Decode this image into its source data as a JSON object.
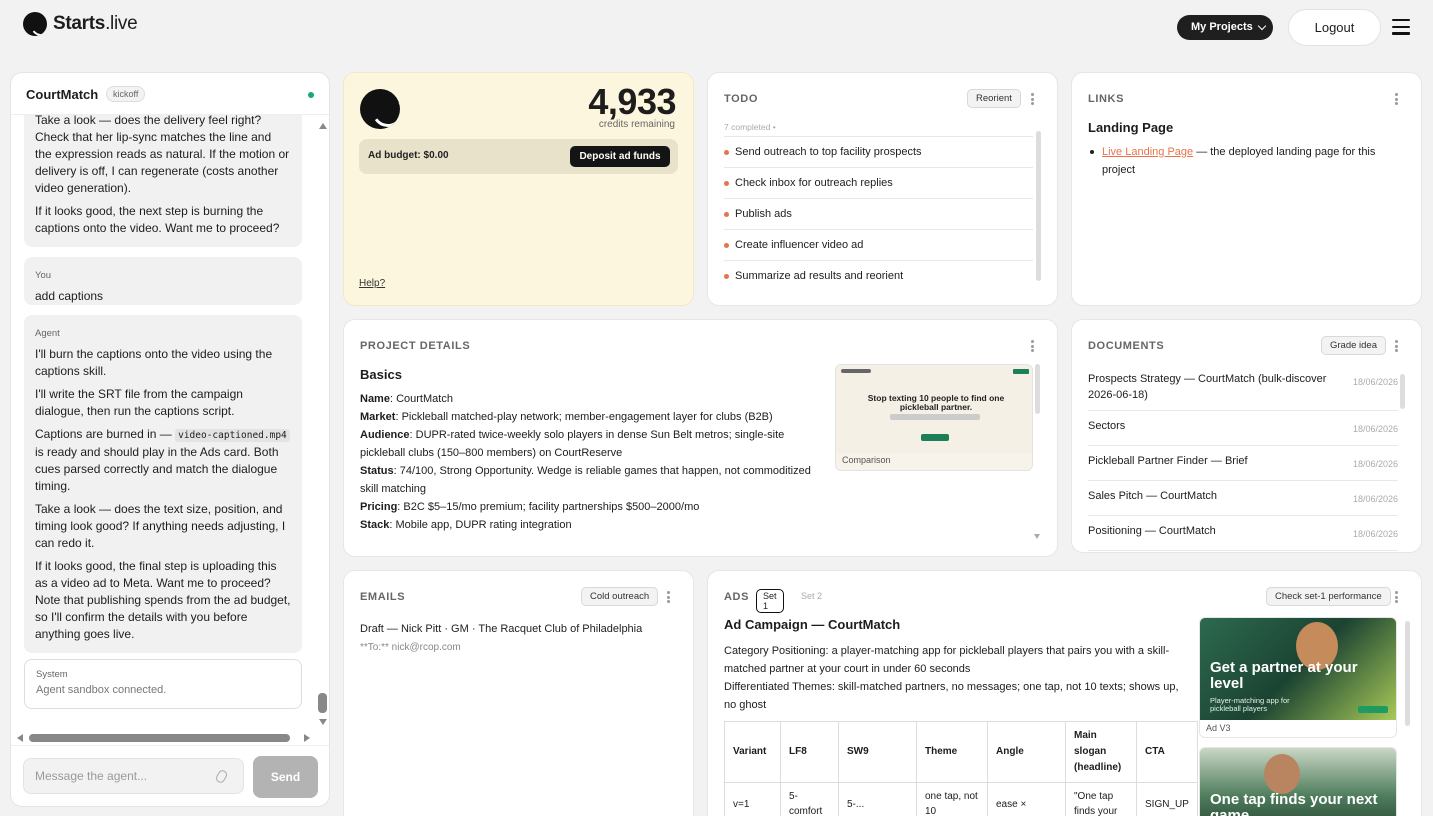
{
  "header": {
    "brand": "Starts",
    "brand_suffix": ".live",
    "projects_label": "My Projects",
    "logout_label": "Logout"
  },
  "chat": {
    "title": "CourtMatch",
    "badge": "kickoff",
    "messages": [
      {
        "who": "",
        "paras": [
          "Take a look — does the delivery feel right? Check that her lip-sync matches the line and the expression reads as natural. If the motion or delivery is off, I can regenerate (costs another video generation).",
          "If it looks good, the next step is burning the captions onto the video. Want me to proceed?"
        ]
      },
      {
        "who": "You",
        "paras": [
          "add captions"
        ]
      },
      {
        "who": "Agent",
        "paras": [
          "I'll burn the captions onto the video using the captions skill.",
          "I'll write the SRT file from the campaign dialogue, then run the captions script.",
          "Captions are burned in —",
          "video-captioned.mp4",
          "is ready and should play in the Ads card. Both cues parsed correctly and match the dialogue timing.",
          "Take a look — does the text size, position, and timing look good? If anything needs adjusting, I can redo it.",
          "If it looks good, the final step is uploading this as a video ad to Meta. Want me to proceed? Note that publishing spends from the ad budget, so I'll confirm the details with you before anything goes live."
        ]
      }
    ],
    "system": {
      "who": "System",
      "text": "Agent sandbox connected."
    },
    "input_placeholder": "Message the agent...",
    "send_label": "Send"
  },
  "credits": {
    "value": "4,933",
    "label": "credits remaining",
    "budget": "Ad budget: $0.00",
    "deposit_label": "Deposit ad funds",
    "help": "Help?"
  },
  "todo": {
    "title": "TODO",
    "action": "Reorient",
    "meta": "7 completed",
    "meta_sep": "•",
    "items": [
      "Send outreach to top facility prospects",
      "Check inbox for outreach replies",
      "Publish ads",
      "Create influencer video ad",
      "Summarize ad results and reorient"
    ]
  },
  "links": {
    "title": "LINKS",
    "heading": "Landing Page",
    "link_text": "Live Landing Page",
    "link_desc": " — the deployed landing page for this project"
  },
  "project": {
    "title": "PROJECT DETAILS",
    "heading": "Basics",
    "fields": [
      {
        "k": "Name",
        "v": ": CourtMatch"
      },
      {
        "k": "Market",
        "v": ": Pickleball matched-play network; member-engagement layer for clubs (B2B)"
      },
      {
        "k": "Audience",
        "v": ": DUPR-rated twice-weekly solo players in dense Sun Belt metros; single-site pickleball clubs (150–800 members) on CourtReserve"
      },
      {
        "k": "Status",
        "v": ": 74/100, Strong Opportunity. Wedge is reliable games that happen, not commoditized skill matching"
      },
      {
        "k": "Pricing",
        "v": ": B2C $5–15/mo premium; facility partnerships $500–2000/mo"
      },
      {
        "k": "Stack",
        "v": ": Mobile app, DUPR rating integration"
      }
    ],
    "screenshot_headline": "Stop texting 10 people to find one pickleball partner.",
    "screenshot_caption": "Comparison"
  },
  "documents": {
    "title": "DOCUMENTS",
    "action": "Grade idea",
    "items": [
      {
        "name": "Prospects Strategy — CourtMatch (bulk-discover 2026-06-18)",
        "date": "18/06/2026"
      },
      {
        "name": "Sectors",
        "date": "18/06/2026"
      },
      {
        "name": "Pickleball Partner Finder — Brief",
        "date": "18/06/2026"
      },
      {
        "name": "Sales Pitch — CourtMatch",
        "date": "18/06/2026"
      },
      {
        "name": "Positioning — CourtMatch",
        "date": "18/06/2026"
      }
    ]
  },
  "emails": {
    "title": "EMAILS",
    "action": "Cold outreach",
    "draft": "Draft — Nick Pitt · GM · The Racquet Club of Philadelphia",
    "to": "**To:** nick@rcop.com"
  },
  "ads": {
    "title": "ADS",
    "tab1": "Set 1",
    "tab2": "Set 2",
    "action": "Check set-1 performance",
    "heading": "Ad Campaign — CourtMatch",
    "positioning": "Category Positioning: a player-matching app for pickleball players that pairs you with a skill-matched partner at your court in under 60 seconds",
    "themes": "Differentiated Themes: skill-matched partners, no messages; one tap, not 10 texts; shows up, no ghost",
    "table_headers": [
      "Variant",
      "LF8",
      "SW9",
      "Theme",
      "Angle",
      "Main slogan (headline)",
      "CTA"
    ],
    "table_row": [
      "v=1",
      "5-comfort",
      "5-...",
      "one tap, not 10",
      "ease ×",
      "\"One tap finds your",
      "SIGN_UP"
    ],
    "thumb1_headline": "Get a partner at your level",
    "thumb1_sub": "Player-matching app for pickleball players",
    "thumb1_caption": "Ad V3",
    "thumb2_headline": "One tap finds your next game"
  }
}
